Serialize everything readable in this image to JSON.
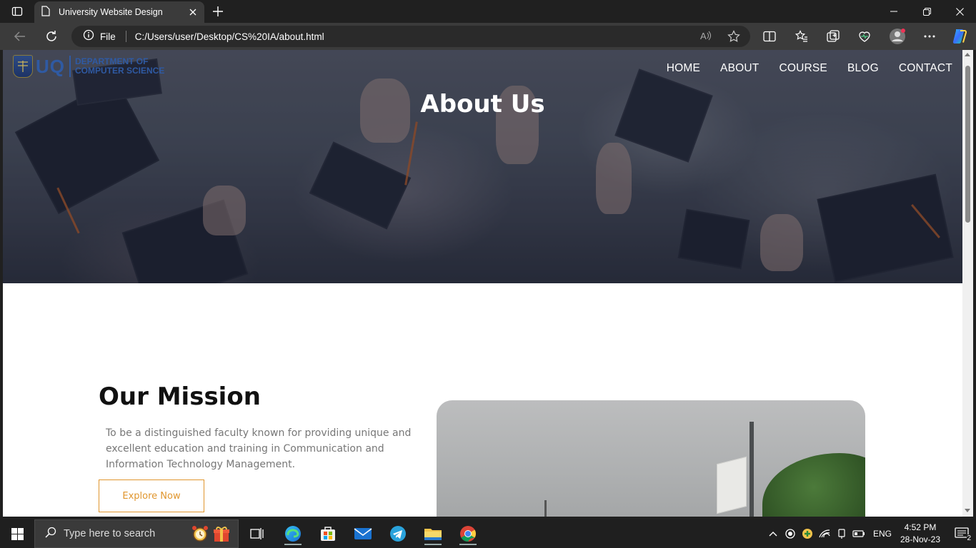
{
  "browser": {
    "tab_title": "University Website Design",
    "omnibox": {
      "scheme_label": "File",
      "url": "C:/Users/user/Desktop/CS%20IA/about.html"
    }
  },
  "site": {
    "logo": {
      "abbr": "UQ",
      "dept_line1": "DEPARTMENT OF",
      "dept_line2": "COMPUTER SCIENCE"
    },
    "nav": [
      "HOME",
      "ABOUT",
      "COURSE",
      "BLOG",
      "CONTACT"
    ],
    "hero_title": "About Us"
  },
  "mission": {
    "title": "Our Mission",
    "text": "To be a distinguished faculty known for providing unique and excellent education and training in Communication and Information Technology Management.",
    "button": "Explore Now"
  },
  "colors": {
    "accent": "#e0962e",
    "logo_blue": "#2f5aa3"
  },
  "taskbar": {
    "search_placeholder": "Type here to search",
    "language": "ENG",
    "time": "4:52 PM",
    "date": "28-Nov-23",
    "notification_count": "2"
  }
}
